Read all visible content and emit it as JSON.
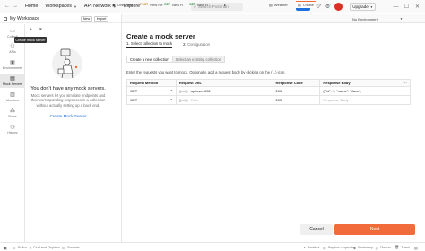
{
  "nav": {
    "home": "Home",
    "workspaces": "Workspaces",
    "api_network": "API Network",
    "explore": "Explore",
    "search_placeholder": "Search Postman",
    "invite": "Invite",
    "upgrade": "Upgrade"
  },
  "sidebar": {
    "workspace_name": "My Workspace",
    "new_label": "New",
    "import_label": "Import",
    "tooltip": "Create mock server",
    "rail": [
      {
        "label": "Collecti",
        "icon": "collections-icon"
      },
      {
        "label": "APIs",
        "icon": "apis-icon"
      },
      {
        "label": "Environments",
        "icon": "environments-icon"
      },
      {
        "label": "Mock Servers",
        "icon": "mock-servers-icon"
      },
      {
        "label": "Monitors",
        "icon": "monitors-icon"
      },
      {
        "label": "Flows",
        "icon": "flows-icon"
      },
      {
        "label": "History",
        "icon": "history-icon"
      }
    ],
    "empty_title": "You don't have any mock servers.",
    "empty_desc": "Mock servers let you simulate endpoints and their corresponding responses in a collection without actually setting up a back end.",
    "create_link": "Create Mock Server"
  },
  "tabs": [
    {
      "method": "",
      "label": "Overview",
      "active": false
    },
    {
      "method": "POST",
      "label": "New Re",
      "active": false
    },
    {
      "method": "GET",
      "label": "New R",
      "active": false
    },
    {
      "method": "GET",
      "label": "New R",
      "active": false
    },
    {
      "method": "",
      "label": "Weather",
      "active": false
    },
    {
      "method": "",
      "label": "Create",
      "active": true
    }
  ],
  "environment": "No Environment",
  "main": {
    "title": "Create a mock server",
    "step1_num": "1.",
    "step1": "Select collection to mock",
    "step2_num": "2.",
    "step2": "Configuration",
    "subtab_new": "Create a new collection",
    "subtab_existing": "Select an existing collection",
    "instructions": "Enter the requests you want to mock. Optionally, add a request body by clicking on the (...) icon.",
    "table": {
      "headers": [
        "Request Method",
        "Request URL",
        "Response Code",
        "Response Body"
      ],
      "url_prefix": "{{url}}",
      "rows": [
        {
          "method": "GET",
          "url": "api/user/002",
          "code": "200",
          "body": "{ \"id\": 1, \"name\": \"Jane\","
        },
        {
          "method": "GET",
          "url": "",
          "url_placeholder": "Path",
          "code": "200",
          "body": "",
          "body_placeholder": "Response Body"
        }
      ]
    },
    "cancel": "Cancel",
    "next": "Next"
  },
  "statusbar": {
    "online": "Online",
    "find_replace": "Find and Replace",
    "console": "Console",
    "cookies": "Cookies",
    "capture": "Capture requests",
    "bootcamp": "Bootcamp",
    "runner": "Runner",
    "trash": "Trash"
  },
  "colors": {
    "accent": "#f26b3a",
    "link": "#1f6fde",
    "alert": "#d93025"
  }
}
